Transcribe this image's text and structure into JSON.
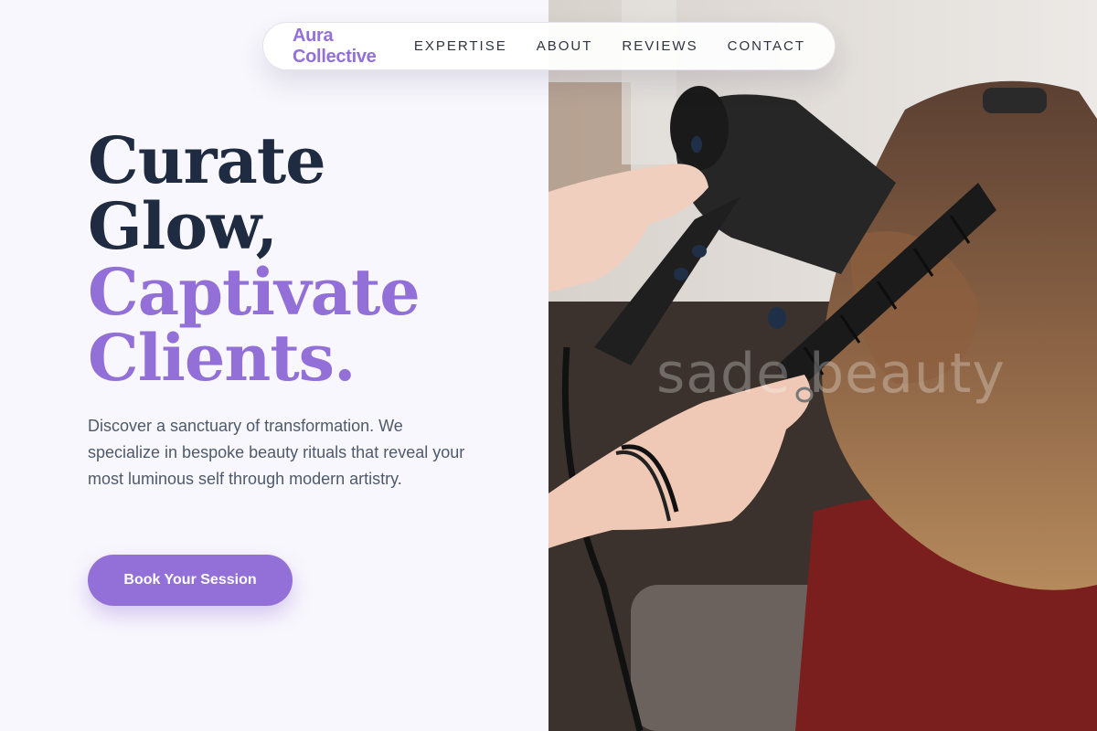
{
  "nav": {
    "brand": "Aura Collective",
    "links": [
      "EXPERTISE",
      "ABOUT",
      "REVIEWS",
      "CONTACT"
    ]
  },
  "hero": {
    "headline_line1": "Curate",
    "headline_line2": "Glow,",
    "headline_line3": "Captivate",
    "headline_line4": "Clients.",
    "description": "Discover a sanctuary of transformation. We specialize in bespoke beauty rituals that reveal your most luminous self through modern artistry.",
    "cta_label": "Book Your Session"
  },
  "image": {
    "watermark": "sade beauty"
  },
  "colors": {
    "accent": "#9370d8",
    "heading_dark": "#1f2b40",
    "body_text": "#4e5a6b",
    "background": "#f8f7fd"
  }
}
